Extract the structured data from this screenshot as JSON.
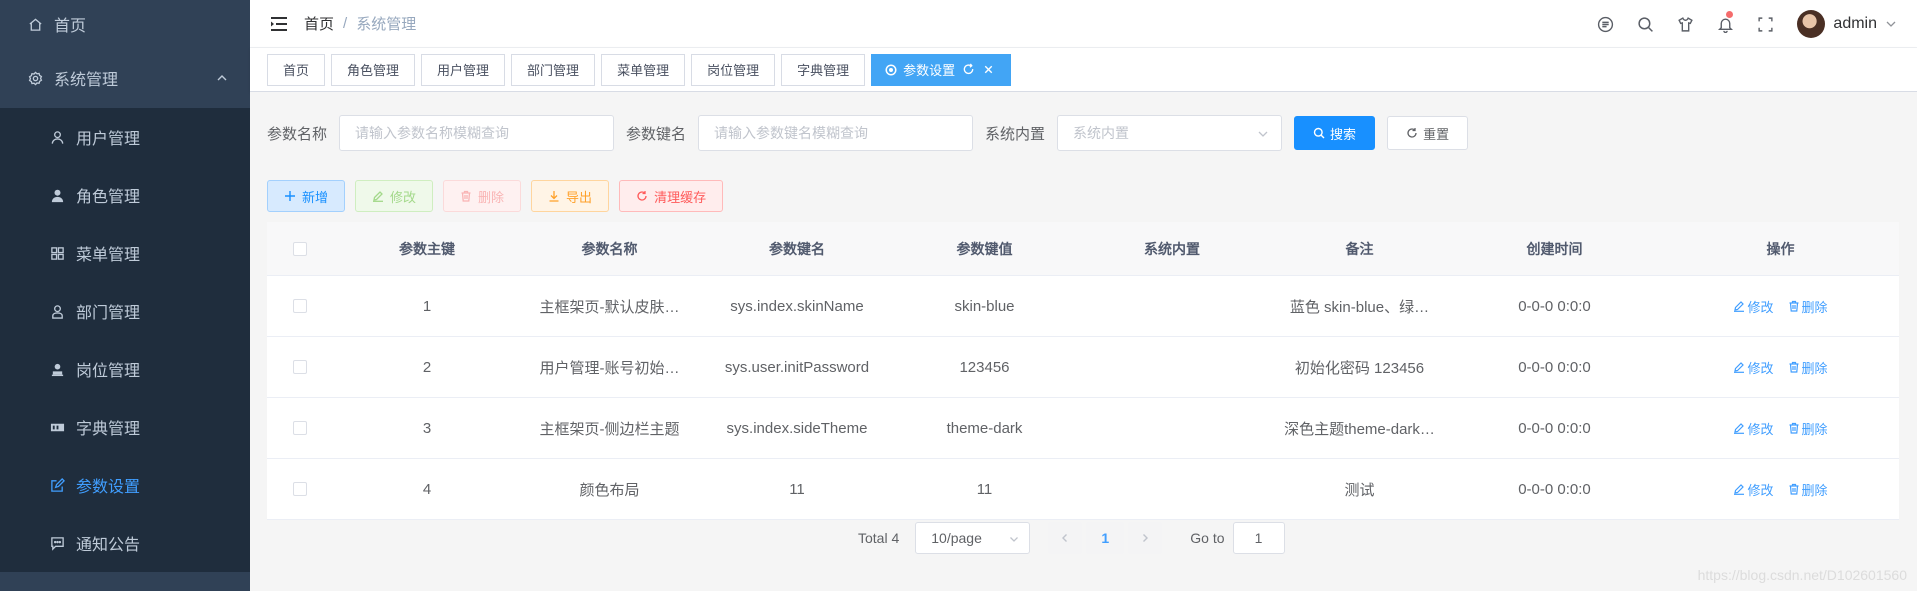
{
  "sidebar": {
    "home_label": "首页",
    "group_label": "系统管理",
    "items": [
      {
        "label": "用户管理",
        "icon": "user-icon"
      },
      {
        "label": "角色管理",
        "icon": "role-icon"
      },
      {
        "label": "菜单管理",
        "icon": "menu-grid-icon"
      },
      {
        "label": "部门管理",
        "icon": "dept-icon"
      },
      {
        "label": "岗位管理",
        "icon": "post-icon"
      },
      {
        "label": "字典管理",
        "icon": "dict-icon"
      },
      {
        "label": "参数设置",
        "icon": "edit-icon",
        "active": true
      },
      {
        "label": "通知公告",
        "icon": "message-icon"
      }
    ]
  },
  "header": {
    "breadcrumb_home": "首页",
    "breadcrumb_sep": "/",
    "breadcrumb_current": "系统管理",
    "username": "admin"
  },
  "tags": [
    "首页",
    "角色管理",
    "用户管理",
    "部门管理",
    "菜单管理",
    "岗位管理",
    "字典管理",
    "参数设置"
  ],
  "search": {
    "label_name": "参数名称",
    "placeholder_name": "请输入参数名称模糊查询",
    "label_key": "参数键名",
    "placeholder_key": "请输入参数键名模糊查询",
    "label_sys": "系统内置",
    "placeholder_sys": "系统内置",
    "search_btn": "搜索",
    "reset_btn": "重置"
  },
  "ops": {
    "add": "新增",
    "edit": "修改",
    "delete": "删除",
    "export": "导出",
    "clear": "清理缓存"
  },
  "table": {
    "headers": {
      "key": "参数主键",
      "name": "参数名称",
      "kname": "参数键名",
      "kval": "参数键值",
      "sys": "系统内置",
      "remark": "备注",
      "time": "创建时间",
      "op": "操作"
    },
    "rows": [
      {
        "key": "1",
        "name": "主框架页-默认皮肤…",
        "kname": "sys.index.skinName",
        "kval": "skin-blue",
        "sys": "",
        "remark": "蓝色 skin-blue、绿…",
        "time": "0-0-0 0:0:0"
      },
      {
        "key": "2",
        "name": "用户管理-账号初始…",
        "kname": "sys.user.initPassword",
        "kval": "123456",
        "sys": "",
        "remark": "初始化密码 123456",
        "time": "0-0-0 0:0:0"
      },
      {
        "key": "3",
        "name": "主框架页-侧边栏主题",
        "kname": "sys.index.sideTheme",
        "kval": "theme-dark",
        "sys": "",
        "remark": "深色主题theme-dark…",
        "time": "0-0-0 0:0:0"
      },
      {
        "key": "4",
        "name": "颜色布局",
        "kname": "11",
        "kval": "11",
        "sys": "",
        "remark": "测试",
        "time": "0-0-0 0:0:0"
      }
    ],
    "row_edit": "修改",
    "row_delete": "删除"
  },
  "pager": {
    "total": "Total 4",
    "page_size": "10/page",
    "current": "1",
    "goto_label": "Go to",
    "goto_value": "1"
  },
  "watermark": "https://blog.csdn.net/D102601560",
  "colors": {
    "sidebar_bg": "#304156",
    "accent": "#409eff",
    "primary": "#1890ff"
  }
}
